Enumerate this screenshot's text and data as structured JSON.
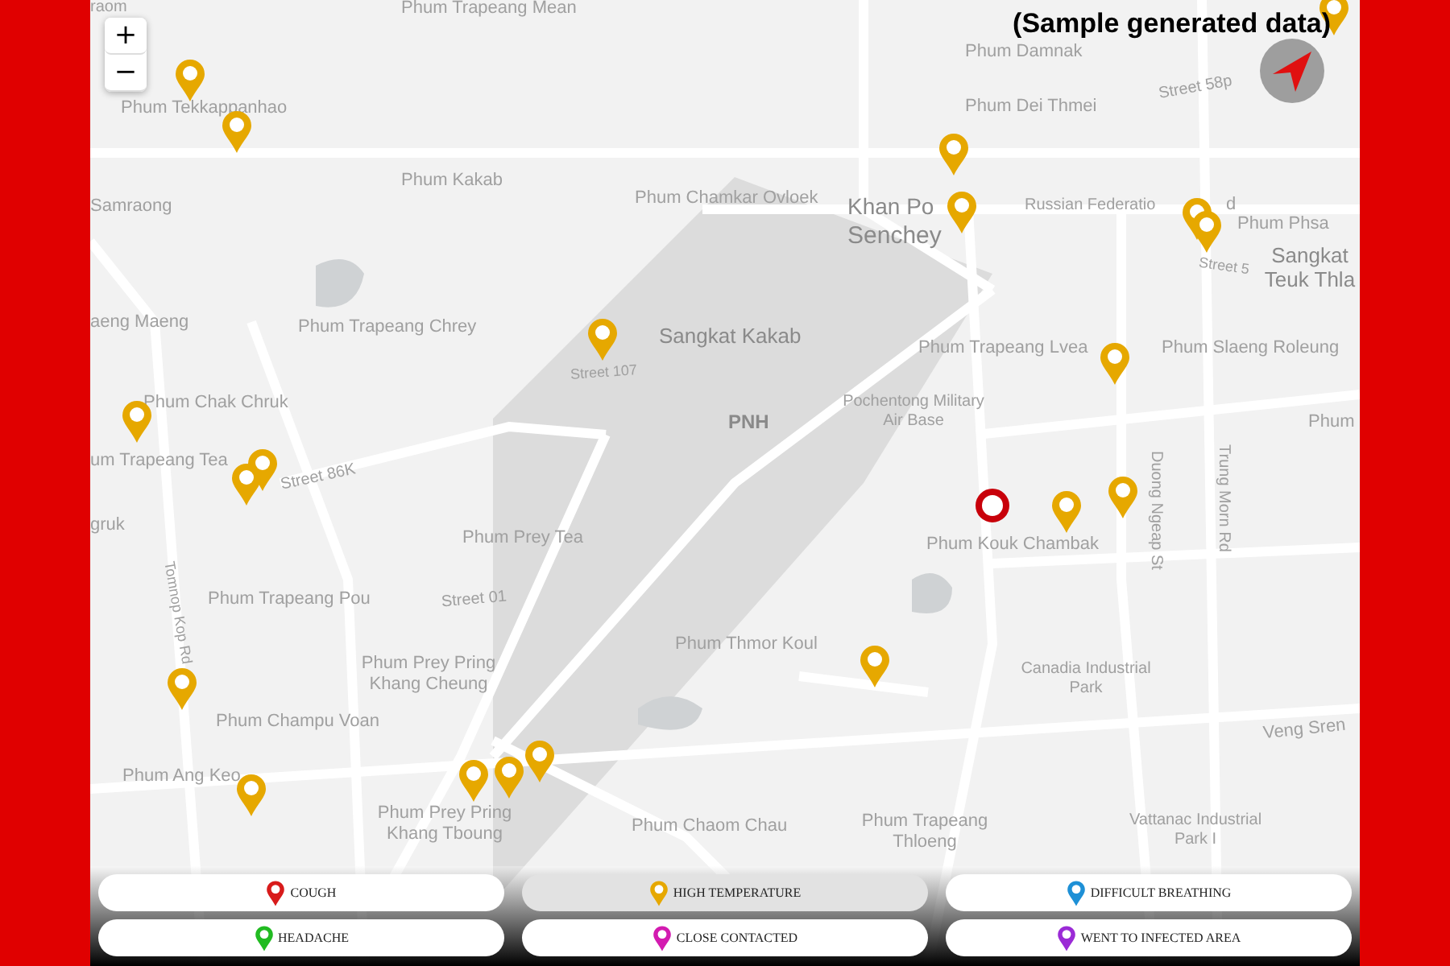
{
  "title": "(Sample generated data)",
  "zoom_controls": [
    "+",
    "−"
  ],
  "map_labels": [
    "raom",
    "Phum Trapeang Mean",
    "Phum Damnak",
    "Phum Tekkappanhao",
    "Phum Dei Thmei",
    "Street 58p",
    "Phum Kakab",
    "Samraong",
    "Phum Chamkar Ovloek",
    "Khan Po",
    "Russian Federatio",
    "d",
    "Phum Phsa",
    "Senchey",
    "Street 5",
    "Sangkat Teuk Thla",
    "aeng Maeng",
    "Phum Trapeang Chrey",
    "Sangkat Kakab",
    "Phum Trapeang Lvea",
    "Phum Slaeng Roleung",
    "Street 107",
    "Phum Chak Chruk",
    "PNH",
    "Pochentong Military Air Base",
    "Phum",
    "um Trapeang Tea",
    "Street 86K",
    "Duong Ngeap St",
    "Trung Morn Rd",
    "gruk",
    "Phum Prey Tea",
    "Phum Kouk Chambak",
    "Tomnop Kop Rd",
    "Phum Trapeang Pou",
    "Street 01",
    "Phum Prey Pring Khang Cheung",
    "Phum Thmor Koul",
    "Canadia Industrial Park",
    "Phum Champu Voan",
    "Veng Sren",
    "Phum Ang Keo",
    "Phum Prey Pring Khang Tboung",
    "Phum Chaom Chau",
    "Phum Trapeang Thloeng",
    "Vattanac Industrial Park I"
  ],
  "markers": [
    {
      "kind": "pin"
    },
    {
      "kind": "pin"
    },
    {
      "kind": "pin"
    },
    {
      "kind": "pin"
    },
    {
      "kind": "pin"
    },
    {
      "kind": "pin"
    },
    {
      "kind": "pin"
    },
    {
      "kind": "pin"
    },
    {
      "kind": "pin"
    },
    {
      "kind": "pin"
    },
    {
      "kind": "pin"
    },
    {
      "kind": "pin"
    },
    {
      "kind": "pin"
    },
    {
      "kind": "pin"
    },
    {
      "kind": "pin"
    },
    {
      "kind": "pin"
    },
    {
      "kind": "pin"
    },
    {
      "kind": "pin"
    },
    {
      "kind": "pin"
    },
    {
      "kind": "pin"
    },
    {
      "kind": "ring"
    }
  ],
  "legend": [
    {
      "label": "COUGH",
      "color": "#d81b1b",
      "selected": false
    },
    {
      "label": "HIGH TEMPERATURE",
      "color": "#e6a800",
      "selected": true
    },
    {
      "label": "DIFFICULT BREATHING",
      "color": "#1e90d6",
      "selected": false
    },
    {
      "label": "HEADACHE",
      "color": "#22bb22",
      "selected": false
    },
    {
      "label": "CLOSE CONTACTED",
      "color": "#d31bb0",
      "selected": false
    },
    {
      "label": "WENT TO INFECTED AREA",
      "color": "#9b2bd6",
      "selected": false
    }
  ]
}
